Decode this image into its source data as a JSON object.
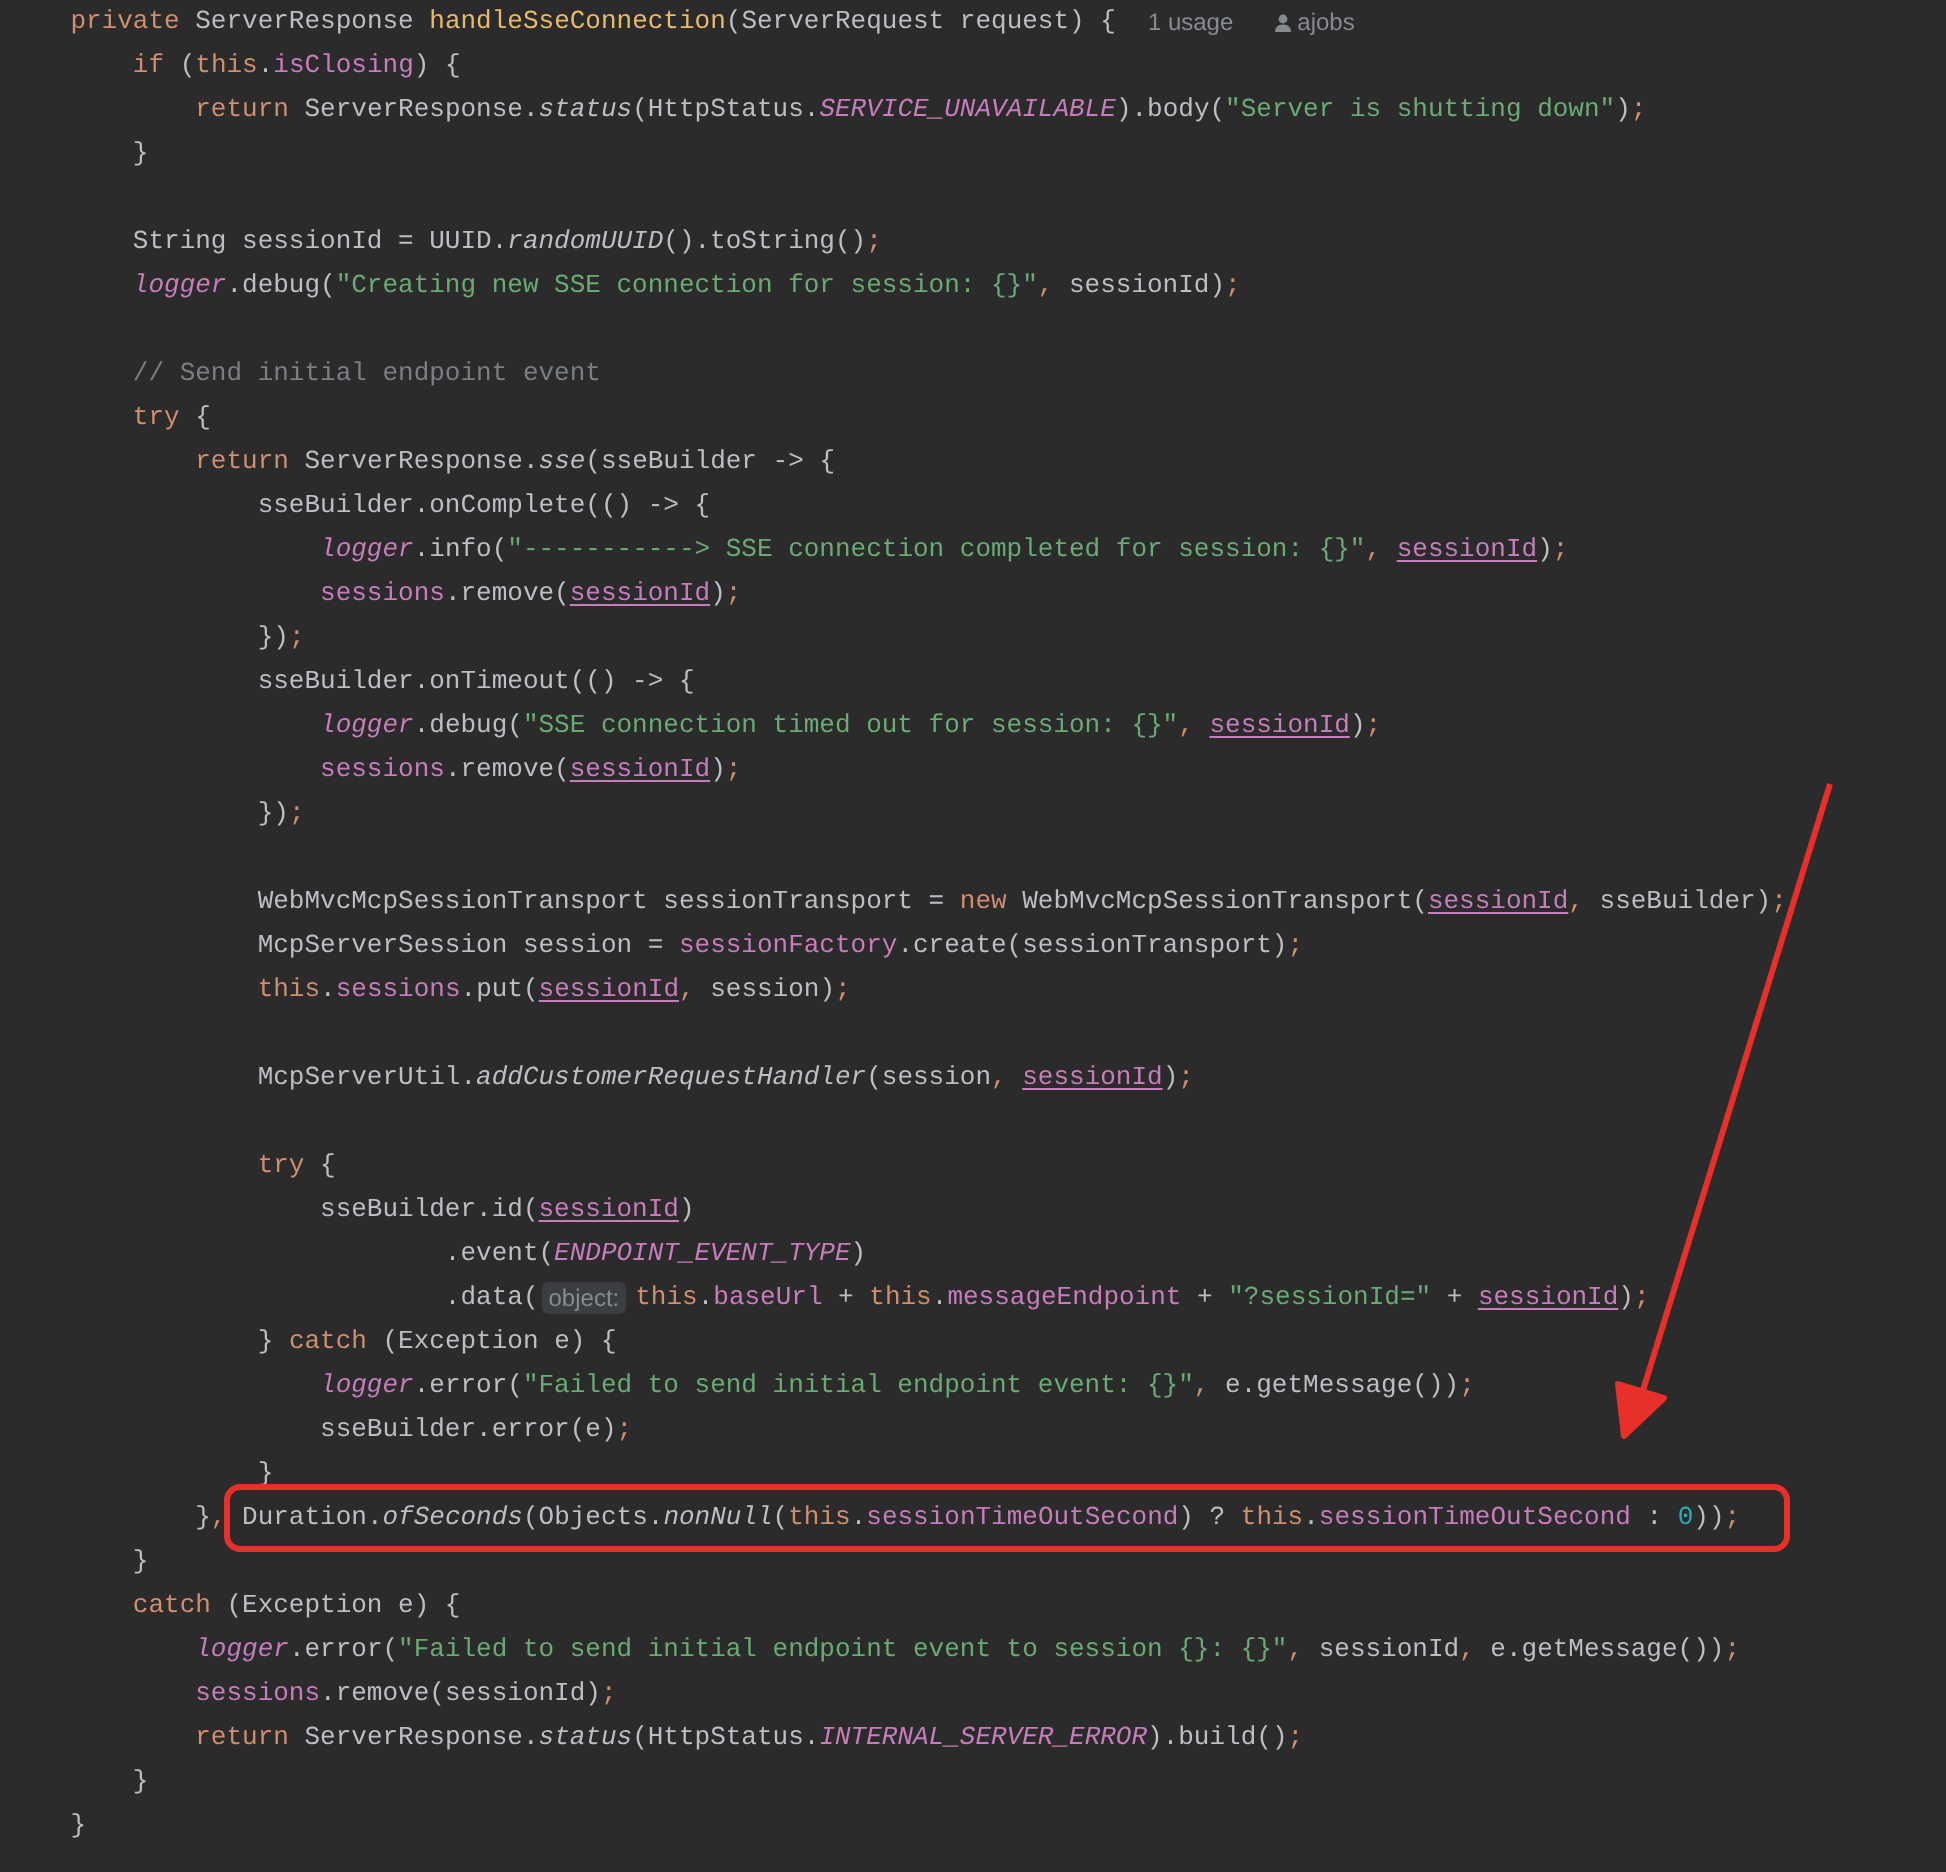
{
  "editor": {
    "lines": [
      {
        "kind": "code",
        "tokens": [
          {
            "kind": "kw",
            "text": "    private "
          },
          {
            "kind": "plain",
            "text": "ServerResponse "
          },
          {
            "kind": "decl",
            "text": "handleSseConnection"
          },
          {
            "kind": "plain",
            "text": "(ServerRequest request) {"
          },
          {
            "kind": "usages",
            "text": "1 usage"
          },
          {
            "kind": "author",
            "text": "ajobs"
          }
        ]
      },
      {
        "kind": "code",
        "tokens": [
          {
            "kind": "kw",
            "text": "        if "
          },
          {
            "kind": "plain",
            "text": "("
          },
          {
            "kind": "kw",
            "text": "this"
          },
          {
            "kind": "plain",
            "text": "."
          },
          {
            "kind": "field",
            "text": "isClosing"
          },
          {
            "kind": "plain",
            "text": ") {"
          }
        ]
      },
      {
        "kind": "code",
        "tokens": [
          {
            "kind": "kw",
            "text": "            return "
          },
          {
            "kind": "plain",
            "text": "ServerResponse."
          },
          {
            "kind": "smethod",
            "text": "status"
          },
          {
            "kind": "plain",
            "text": "(HttpStatus."
          },
          {
            "kind": "sfield",
            "text": "SERVICE_UNAVAILABLE"
          },
          {
            "kind": "plain",
            "text": ").body("
          },
          {
            "kind": "str",
            "text": "\"Server is shutting down\""
          },
          {
            "kind": "plain",
            "text": ")"
          },
          {
            "kind": "punct",
            "text": ";"
          }
        ]
      },
      {
        "kind": "code",
        "tokens": [
          {
            "kind": "plain",
            "text": "        }"
          }
        ]
      },
      {
        "kind": "blank"
      },
      {
        "kind": "code",
        "tokens": [
          {
            "kind": "plain",
            "text": "        String sessionId = UUID."
          },
          {
            "kind": "smethod",
            "text": "randomUUID"
          },
          {
            "kind": "plain",
            "text": "().toString()"
          },
          {
            "kind": "punct",
            "text": ";"
          }
        ]
      },
      {
        "kind": "code",
        "tokens": [
          {
            "kind": "sfield",
            "text": "        logger"
          },
          {
            "kind": "plain",
            "text": ".debug("
          },
          {
            "kind": "str",
            "text": "\"Creating new SSE connection for session: {}\""
          },
          {
            "kind": "punct",
            "text": ", "
          },
          {
            "kind": "plain",
            "text": "sessionId)"
          },
          {
            "kind": "punct",
            "text": ";"
          }
        ]
      },
      {
        "kind": "blank"
      },
      {
        "kind": "code",
        "tokens": [
          {
            "kind": "comment",
            "text": "        // Send initial endpoint event"
          }
        ]
      },
      {
        "kind": "code",
        "tokens": [
          {
            "kind": "kw",
            "text": "        try "
          },
          {
            "kind": "plain",
            "text": "{"
          }
        ]
      },
      {
        "kind": "code",
        "tokens": [
          {
            "kind": "kw",
            "text": "            return "
          },
          {
            "kind": "plain",
            "text": "ServerResponse."
          },
          {
            "kind": "smethod",
            "text": "sse"
          },
          {
            "kind": "plain",
            "text": "(sseBuilder -> {"
          }
        ]
      },
      {
        "kind": "code",
        "tokens": [
          {
            "kind": "plain",
            "text": "                sseBuilder.onComplete(() -> {"
          }
        ]
      },
      {
        "kind": "code",
        "tokens": [
          {
            "kind": "sfield",
            "text": "                    logger"
          },
          {
            "kind": "plain",
            "text": ".info("
          },
          {
            "kind": "str",
            "text": "\"-----------> SSE connection completed for session: {}\""
          },
          {
            "kind": "punct",
            "text": ", "
          },
          {
            "kind": "captured",
            "text": "sessionId"
          },
          {
            "kind": "plain",
            "text": ")"
          },
          {
            "kind": "punct",
            "text": ";"
          }
        ]
      },
      {
        "kind": "code",
        "tokens": [
          {
            "kind": "field",
            "text": "                    sessions"
          },
          {
            "kind": "plain",
            "text": ".remove("
          },
          {
            "kind": "captured",
            "text": "sessionId"
          },
          {
            "kind": "plain",
            "text": ")"
          },
          {
            "kind": "punct",
            "text": ";"
          }
        ]
      },
      {
        "kind": "code",
        "tokens": [
          {
            "kind": "plain",
            "text": "                })"
          },
          {
            "kind": "punct",
            "text": ";"
          }
        ]
      },
      {
        "kind": "code",
        "tokens": [
          {
            "kind": "plain",
            "text": "                sseBuilder.onTimeout(() -> {"
          }
        ]
      },
      {
        "kind": "code",
        "tokens": [
          {
            "kind": "sfield",
            "text": "                    logger"
          },
          {
            "kind": "plain",
            "text": ".debug("
          },
          {
            "kind": "str",
            "text": "\"SSE connection timed out for session: {}\""
          },
          {
            "kind": "punct",
            "text": ", "
          },
          {
            "kind": "captured",
            "text": "sessionId"
          },
          {
            "kind": "plain",
            "text": ")"
          },
          {
            "kind": "punct",
            "text": ";"
          }
        ]
      },
      {
        "kind": "code",
        "tokens": [
          {
            "kind": "field",
            "text": "                    sessions"
          },
          {
            "kind": "plain",
            "text": ".remove("
          },
          {
            "kind": "captured",
            "text": "sessionId"
          },
          {
            "kind": "plain",
            "text": ")"
          },
          {
            "kind": "punct",
            "text": ";"
          }
        ]
      },
      {
        "kind": "code",
        "tokens": [
          {
            "kind": "plain",
            "text": "                })"
          },
          {
            "kind": "punct",
            "text": ";"
          }
        ]
      },
      {
        "kind": "blank"
      },
      {
        "kind": "code",
        "tokens": [
          {
            "kind": "plain",
            "text": "                WebMvcMcpSessionTransport sessionTransport = "
          },
          {
            "kind": "kw",
            "text": "new "
          },
          {
            "kind": "plain",
            "text": "WebMvcMcpSessionTransport("
          },
          {
            "kind": "captured",
            "text": "sessionId"
          },
          {
            "kind": "punct",
            "text": ", "
          },
          {
            "kind": "plain",
            "text": "sseBuilder)"
          },
          {
            "kind": "punct",
            "text": ";"
          }
        ]
      },
      {
        "kind": "code",
        "tokens": [
          {
            "kind": "plain",
            "text": "                McpServerSession session = "
          },
          {
            "kind": "field",
            "text": "sessionFactory"
          },
          {
            "kind": "plain",
            "text": ".create(sessionTransport)"
          },
          {
            "kind": "punct",
            "text": ";"
          }
        ]
      },
      {
        "kind": "code",
        "tokens": [
          {
            "kind": "kw",
            "text": "                this"
          },
          {
            "kind": "plain",
            "text": "."
          },
          {
            "kind": "field",
            "text": "sessions"
          },
          {
            "kind": "plain",
            "text": ".put("
          },
          {
            "kind": "captured",
            "text": "sessionId"
          },
          {
            "kind": "punct",
            "text": ", "
          },
          {
            "kind": "plain",
            "text": "session)"
          },
          {
            "kind": "punct",
            "text": ";"
          }
        ]
      },
      {
        "kind": "blank"
      },
      {
        "kind": "code",
        "tokens": [
          {
            "kind": "plain",
            "text": "                McpServerUtil."
          },
          {
            "kind": "smethod",
            "text": "addCustomerRequestHandler"
          },
          {
            "kind": "plain",
            "text": "(session"
          },
          {
            "kind": "punct",
            "text": ", "
          },
          {
            "kind": "captured",
            "text": "sessionId"
          },
          {
            "kind": "plain",
            "text": ")"
          },
          {
            "kind": "punct",
            "text": ";"
          }
        ]
      },
      {
        "kind": "blank"
      },
      {
        "kind": "code",
        "tokens": [
          {
            "kind": "kw",
            "text": "                try "
          },
          {
            "kind": "plain",
            "text": "{"
          }
        ]
      },
      {
        "kind": "code",
        "tokens": [
          {
            "kind": "plain",
            "text": "                    sseBuilder.id("
          },
          {
            "kind": "captured",
            "text": "sessionId"
          },
          {
            "kind": "plain",
            "text": ")"
          }
        ]
      },
      {
        "kind": "code",
        "tokens": [
          {
            "kind": "plain",
            "text": "                            .event("
          },
          {
            "kind": "sfield",
            "text": "ENDPOINT_EVENT_TYPE"
          },
          {
            "kind": "plain",
            "text": ")"
          }
        ]
      },
      {
        "kind": "code",
        "tokens": [
          {
            "kind": "plain",
            "text": "                            .data("
          },
          {
            "kind": "hint",
            "text": "object:"
          },
          {
            "kind": "kw",
            "text": "this"
          },
          {
            "kind": "plain",
            "text": "."
          },
          {
            "kind": "field",
            "text": "baseUrl"
          },
          {
            "kind": "plain",
            "text": " + "
          },
          {
            "kind": "kw",
            "text": "this"
          },
          {
            "kind": "plain",
            "text": "."
          },
          {
            "kind": "field",
            "text": "messageEndpoint"
          },
          {
            "kind": "plain",
            "text": " + "
          },
          {
            "kind": "str",
            "text": "\"?sessionId=\""
          },
          {
            "kind": "plain",
            "text": " + "
          },
          {
            "kind": "captured",
            "text": "sessionId"
          },
          {
            "kind": "plain",
            "text": ")"
          },
          {
            "kind": "punct",
            "text": ";"
          }
        ]
      },
      {
        "kind": "code",
        "tokens": [
          {
            "kind": "plain",
            "text": "                } "
          },
          {
            "kind": "kw",
            "text": "catch "
          },
          {
            "kind": "plain",
            "text": "(Exception e) {"
          }
        ]
      },
      {
        "kind": "code",
        "tokens": [
          {
            "kind": "sfield",
            "text": "                    logger"
          },
          {
            "kind": "plain",
            "text": ".error("
          },
          {
            "kind": "str",
            "text": "\"Failed to send initial endpoint event: {}\""
          },
          {
            "kind": "punct",
            "text": ", "
          },
          {
            "kind": "plain",
            "text": "e.getMessage())"
          },
          {
            "kind": "punct",
            "text": ";"
          }
        ]
      },
      {
        "kind": "code",
        "tokens": [
          {
            "kind": "plain",
            "text": "                    sseBuilder.error(e)"
          },
          {
            "kind": "punct",
            "text": ";"
          }
        ]
      },
      {
        "kind": "code",
        "tokens": [
          {
            "kind": "plain",
            "text": "                }"
          }
        ]
      },
      {
        "kind": "code",
        "tokens": [
          {
            "kind": "plain",
            "text": "            }"
          },
          {
            "kind": "punct",
            "text": ", "
          }
        ],
        "boxed_tokens": [
          {
            "kind": "plain",
            "text": "Duration."
          },
          {
            "kind": "smethod",
            "text": "ofSeconds"
          },
          {
            "kind": "plain",
            "text": "(Objects."
          },
          {
            "kind": "smethod",
            "text": "nonNull"
          },
          {
            "kind": "plain",
            "text": "("
          },
          {
            "kind": "kw",
            "text": "this"
          },
          {
            "kind": "plain",
            "text": "."
          },
          {
            "kind": "field",
            "text": "sessionTimeOutSecond"
          },
          {
            "kind": "plain",
            "text": ") ? "
          },
          {
            "kind": "kw",
            "text": "this"
          },
          {
            "kind": "plain",
            "text": "."
          },
          {
            "kind": "field",
            "text": "sessionTimeOutSecond"
          },
          {
            "kind": "plain",
            "text": " : "
          },
          {
            "kind": "num",
            "text": "0"
          },
          {
            "kind": "plain",
            "text": "))"
          },
          {
            "kind": "punct",
            "text": ";"
          }
        ]
      },
      {
        "kind": "code",
        "tokens": [
          {
            "kind": "plain",
            "text": "        }"
          }
        ]
      },
      {
        "kind": "code",
        "tokens": [
          {
            "kind": "kw",
            "text": "        catch "
          },
          {
            "kind": "plain",
            "text": "(Exception e) {"
          }
        ]
      },
      {
        "kind": "code",
        "tokens": [
          {
            "kind": "sfield",
            "text": "            logger"
          },
          {
            "kind": "plain",
            "text": ".error("
          },
          {
            "kind": "str",
            "text": "\"Failed to send initial endpoint event to session {}: {}\""
          },
          {
            "kind": "punct",
            "text": ", "
          },
          {
            "kind": "plain",
            "text": "sessionId"
          },
          {
            "kind": "punct",
            "text": ", "
          },
          {
            "kind": "plain",
            "text": "e.getMessage())"
          },
          {
            "kind": "punct",
            "text": ";"
          }
        ]
      },
      {
        "kind": "code",
        "tokens": [
          {
            "kind": "field",
            "text": "            sessions"
          },
          {
            "kind": "plain",
            "text": ".remove(sessionId)"
          },
          {
            "kind": "punct",
            "text": ";"
          }
        ]
      },
      {
        "kind": "code",
        "tokens": [
          {
            "kind": "kw",
            "text": "            return "
          },
          {
            "kind": "plain",
            "text": "ServerResponse."
          },
          {
            "kind": "smethod",
            "text": "status"
          },
          {
            "kind": "plain",
            "text": "(HttpStatus."
          },
          {
            "kind": "sfield",
            "text": "INTERNAL_SERVER_ERROR"
          },
          {
            "kind": "plain",
            "text": ").build()"
          },
          {
            "kind": "punct",
            "text": ";"
          }
        ]
      },
      {
        "kind": "code",
        "tokens": [
          {
            "kind": "plain",
            "text": "        }"
          }
        ]
      },
      {
        "kind": "code",
        "tokens": [
          {
            "kind": "plain",
            "text": "    }"
          }
        ]
      }
    ]
  }
}
